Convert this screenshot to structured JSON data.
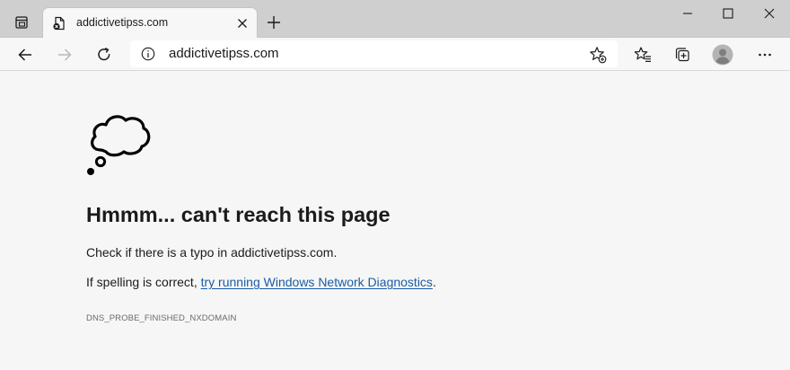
{
  "tab": {
    "title": "addictivetipss.com"
  },
  "toolbar": {
    "url": "addictivetipss.com"
  },
  "error": {
    "heading": "Hmmm... can't reach this page",
    "typo_line": "Check if there is a typo in addictivetipss.com.",
    "spelling_prefix": "If spelling is correct, ",
    "diagnostics_link": "try running Windows Network Diagnostics",
    "spelling_suffix": ".",
    "code": "DNS_PROBE_FINISHED_NXDOMAIN"
  },
  "icons": {
    "tab_actions": "tab-actions-icon",
    "favicon": "error-page-icon",
    "tab_close": "close-icon",
    "new_tab": "plus-icon",
    "minimize": "minimize-icon",
    "maximize": "maximize-icon",
    "close_window": "close-icon",
    "back": "back-arrow-icon",
    "forward": "forward-arrow-icon",
    "refresh": "refresh-icon",
    "site_info": "info-icon",
    "add_favorite": "star-add-icon",
    "favorites": "favorites-icon",
    "collections": "collections-icon",
    "profile": "profile-icon",
    "more": "more-icon",
    "illustration": "thought-cloud-icon"
  }
}
